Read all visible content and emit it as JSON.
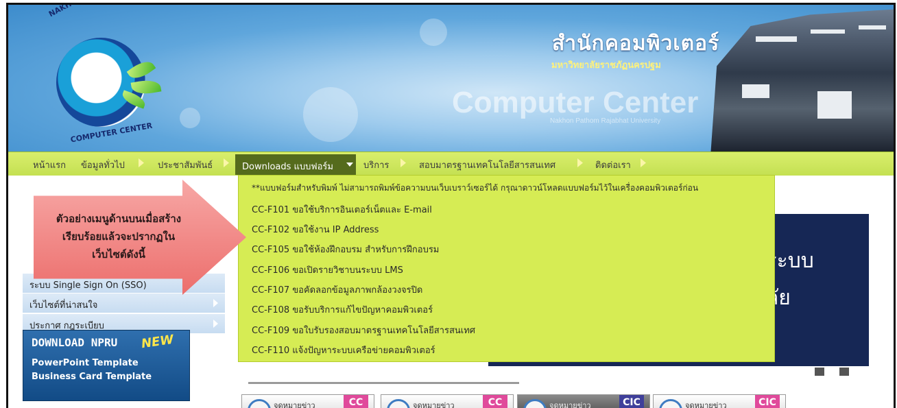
{
  "header": {
    "logo_arc_top": "NAKHON PATHOM RAJABHAT UNIVERSITY",
    "logo_arc_bottom": "COMPUTER CENTER",
    "title_th": "สำนักคอมพิวเตอร์",
    "subtitle_th": "มหาวิทยาลัยราชภัฏนครปฐม",
    "title_en": "Computer Center",
    "subtitle_en": "Nakhon Pathom Rajabhat University"
  },
  "nav": {
    "items": [
      "หน้าแรก",
      "ข้อมูลทั่วไป",
      "ประชาสัมพันธ์",
      "Downloads แบบฟอร์ม",
      "บริการ",
      "สอบมาตรฐานเทคโนโลยีสารสนเทศ",
      "ติดต่อเรา"
    ],
    "active": "Downloads แบบฟอร์ม"
  },
  "dropdown": {
    "items": [
      "**แบบฟอร์มสำหรับพิมพ์ ไม่สามารถพิมพ์ข้อความบนเว็บเบราว์เซอร์ได้ กรุณาดาวน์โหลดแบบฟอร์มไว้ในเครื่องคอมพิวเตอร์ก่อน",
      "CC-F101 ขอใช้บริการอินเตอร์เน็ตและ E-mail",
      "CC-F102 ขอใช้งาน IP Address",
      "CC-F105 ขอใช้ห้องฝึกอบรม สำหรับการฝึกอบรม",
      "CC-F106 ขอเปิดรายวิชาบนระบบ LMS",
      "CC-F107 ขอคัดลอกข้อมูลภาพกล้องวงจรปิด",
      "CC-F108 ขอรับบริการแก้ไขปัญหาคอมพิวเตอร์",
      "CC-F109 ขอใบรับรองสอบมาตรฐานเทคโนโลยีสารสนเทศ",
      "CC-F110 แจ้งปัญหาระบบเครือข่ายคอมพิวเตอร์"
    ]
  },
  "sidebar": {
    "items": [
      "ระบบ Single Sign On (SSO)",
      "เว็บไซต์ที่น่าสนใจ",
      "ประกาศ กฎระเบียบ"
    ],
    "download_banner": {
      "title": "DOWNLOAD NPRU",
      "badge": "NEW",
      "line1": "PowerPoint Template",
      "line2": "Business Card Template"
    }
  },
  "callout": {
    "line1": "ตัวอย่างเมนูด้านบนเมื่อสร้าง",
    "line2": "เรียบร้อยแล้วจะปรากฏใน",
    "line3": "เว็บไซต์ดังนี้"
  },
  "slider": {
    "text1": "นระบบ",
    "text2": "าลัย"
  },
  "news": [
    {
      "label": "จดหมายข่าว",
      "badge": "CC"
    },
    {
      "label": "จดหมายข่าว",
      "badge": "CC"
    },
    {
      "label": "จดหมายข่าว",
      "badge": "CIC"
    },
    {
      "label": "จดหมายข่าว",
      "badge": "CIC"
    }
  ],
  "colors": {
    "nav_bg": "#c4e052",
    "nav_active": "#556b1c",
    "dropdown_bg": "#d6ec54",
    "callout": "#ec6e6c",
    "slider_bg": "#162755"
  }
}
